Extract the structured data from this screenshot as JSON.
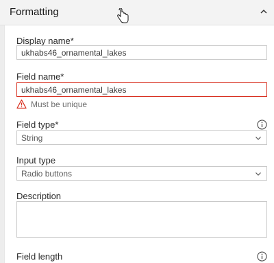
{
  "header": {
    "title": "Formatting"
  },
  "form": {
    "display_name": {
      "label": "Display name*",
      "value": "ukhabs46_ornamental_lakes"
    },
    "field_name": {
      "label": "Field name*",
      "value": "ukhabs46_ornamental_lakes",
      "error": "Must be unique"
    },
    "field_type": {
      "label": "Field type*",
      "value": "String"
    },
    "input_type": {
      "label": "Input type",
      "value": "Radio buttons"
    },
    "description": {
      "label": "Description",
      "value": ""
    },
    "field_length": {
      "label": "Field length"
    }
  },
  "icons": {
    "collapse": "chevron-up-icon",
    "dropdown": "chevron-down-icon",
    "info": "info-icon",
    "warning": "warning-icon",
    "cursor": "hand-pointer-icon"
  },
  "colors": {
    "error": "#d83020",
    "header_bg": "#f3f3f3"
  }
}
